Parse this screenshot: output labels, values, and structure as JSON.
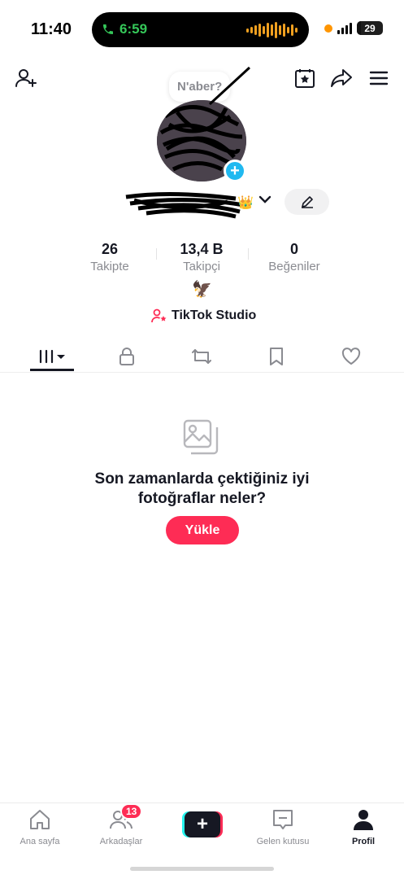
{
  "status_bar": {
    "time": "11:40",
    "call_duration": "6:59",
    "battery": "29"
  },
  "profile": {
    "note": "N'aber?",
    "icons": {
      "add_friend": "person-plus-icon",
      "calendar": "calendar-star-icon",
      "share": "share-arrow-icon",
      "menu": "hamburger-menu-icon",
      "edit": "pencil-icon"
    }
  },
  "stats": [
    {
      "value": "26",
      "label": "Takipte"
    },
    {
      "value": "13,4 B",
      "label": "Takipçi"
    },
    {
      "value": "0",
      "label": "Beğeniler"
    }
  ],
  "bio_emoji": "🦅",
  "studio": {
    "label": "TikTok Studio"
  },
  "tabs": [
    {
      "name": "videos-grid",
      "icon": "grid-dropdown-icon"
    },
    {
      "name": "private",
      "icon": "lock-icon"
    },
    {
      "name": "reposts",
      "icon": "repost-icon"
    },
    {
      "name": "favorites",
      "icon": "bookmark-icon"
    },
    {
      "name": "liked",
      "icon": "heart-icon"
    }
  ],
  "empty_state": {
    "title_line1": "Son zamanlarda çektiğiniz iyi",
    "title_line2": "fotoğraflar neler?",
    "button": "Yükle"
  },
  "bottom_nav": {
    "home": "Ana sayfa",
    "friends": "Arkadaşlar",
    "friends_badge": "13",
    "inbox": "Gelen kutusu",
    "profile": "Profil"
  },
  "colors": {
    "accent": "#fe2c55",
    "cyan": "#25f4ee",
    "text": "#161823",
    "muted": "#8a8b91"
  }
}
